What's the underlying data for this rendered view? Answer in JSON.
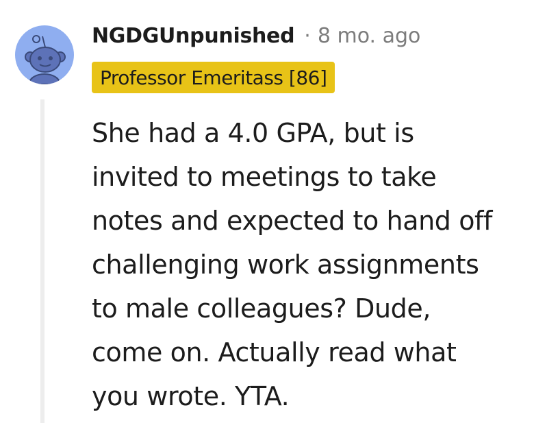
{
  "comment": {
    "author": "NGDGUnpunished",
    "separator": "·",
    "timestamp": "8 mo. ago",
    "flair": "Professor Emeritass [86]",
    "body_lines": [
      "She had a 4.0 GPA, but is",
      "invited to meetings to take",
      "notes and expected to hand off",
      "challenging work assignments",
      "to male colleagues? Dude,",
      "come on. Actually read what",
      "you wrote. YTA."
    ],
    "avatar_icon": "reddit-snoo-default-avatar"
  },
  "colors": {
    "flair_background": "#e8c317",
    "avatar_background": "#8faef0",
    "thread_line": "#ededed",
    "meta_text": "#7c7c7c",
    "body_text": "#1c1c1c"
  }
}
